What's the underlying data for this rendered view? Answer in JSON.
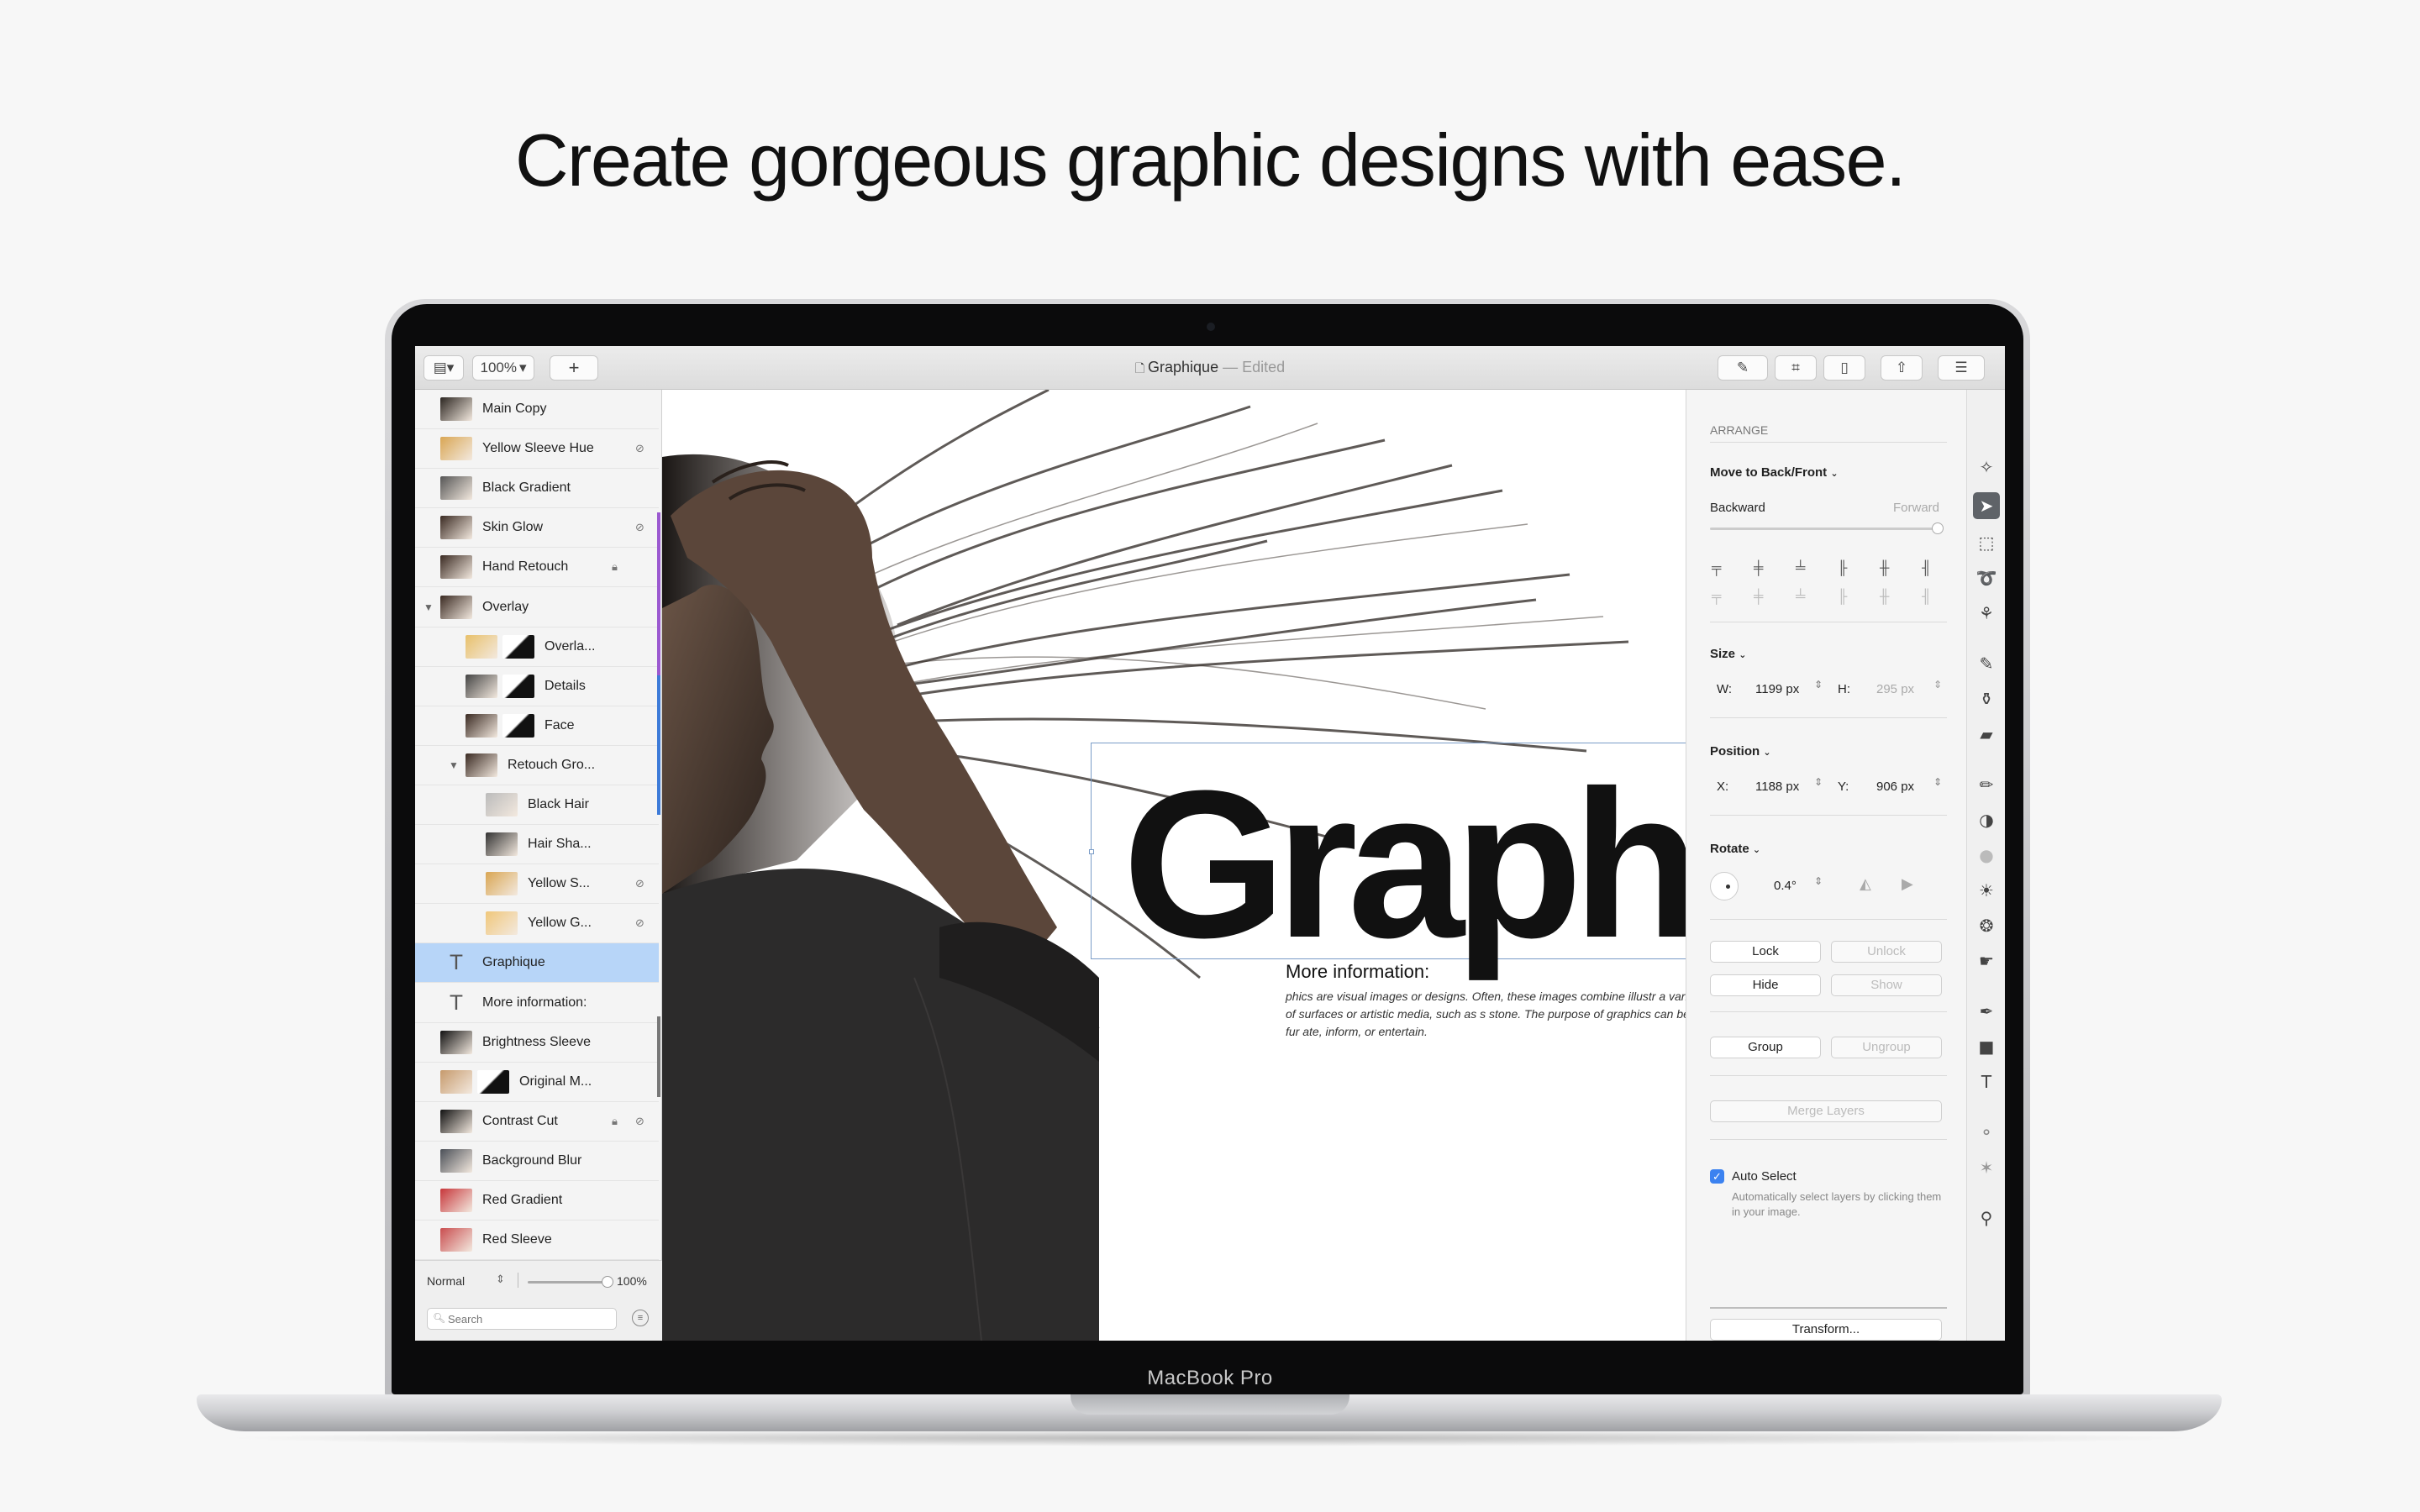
{
  "headline": "Create gorgeous graphic designs with ease.",
  "device_label": "MacBook Pro",
  "toolbar": {
    "view_icon": "sidebar-icon",
    "zoom": "100%",
    "add_label": "+",
    "doc_name": "Graphique",
    "doc_separator": " — ",
    "doc_state": "Edited",
    "right_buttons": [
      "brush-icon",
      "crop-icon",
      "document-icon",
      "share-icon",
      "sliders-icon"
    ]
  },
  "layers": [
    {
      "label": "Main Copy",
      "thumb": "#2b2520",
      "indent": 0
    },
    {
      "label": "Yellow Sleeve Hue",
      "thumb": "#d9a653",
      "indent": 0,
      "badge": "hidden-icon"
    },
    {
      "label": "Black Gradient",
      "thumb": "#555",
      "indent": 0
    },
    {
      "label": "Skin Glow",
      "thumb": "#3a2a22",
      "indent": 0,
      "badge": "hidden-icon"
    },
    {
      "label": "Hand Retouch",
      "thumb": "#3a2a22",
      "indent": 0,
      "badge": "lock-icon"
    },
    {
      "label": "Overlay",
      "thumb": "#3a2a22",
      "indent": 0,
      "group": "open"
    },
    {
      "label": "Overla...",
      "thumb": "#e8c06a",
      "thumb2": "#111",
      "indent": 1
    },
    {
      "label": "Details",
      "thumb": "#444",
      "thumb2": "#111",
      "indent": 1
    },
    {
      "label": "Face",
      "thumb": "#3a2a22",
      "thumb2": "#111",
      "indent": 1
    },
    {
      "label": "Retouch Gro...",
      "thumb": "#3a2a22",
      "indent": 1,
      "group": "open"
    },
    {
      "label": "Black Hair",
      "thumb": "#bbb",
      "indent": 2
    },
    {
      "label": "Hair Sha...",
      "thumb": "#333",
      "indent": 2
    },
    {
      "label": "Yellow S...",
      "thumb": "#d9a653",
      "indent": 2,
      "badge": "hidden-icon"
    },
    {
      "label": "Yellow G...",
      "thumb": "#f0c77a",
      "indent": 2,
      "badge": "hidden-icon"
    },
    {
      "label": "Graphique",
      "type": "text",
      "indent": 0,
      "selected": true
    },
    {
      "label": "More information:",
      "type": "text",
      "indent": 0
    },
    {
      "label": "Brightness Sleeve",
      "thumb": "#111",
      "indent": 0
    },
    {
      "label": "Original M...",
      "thumb": "#c69a6c",
      "thumb2": "#111",
      "indent": 0
    },
    {
      "label": "Contrast Cut",
      "thumb": "#111",
      "indent": 0,
      "badge": "lock-icon",
      "badge2": "hidden-icon"
    },
    {
      "label": "Background Blur",
      "thumb": "#4a4f57",
      "indent": 0
    },
    {
      "label": "Red Gradient",
      "thumb": "#c7363a",
      "indent": 0
    },
    {
      "label": "Red Sleeve",
      "thumb": "#c94d4f",
      "indent": 0
    }
  ],
  "layers_footer": {
    "blend_mode": "Normal",
    "opacity": "100%",
    "opacity_value": 1.0,
    "search_placeholder": "Search"
  },
  "canvas": {
    "big_word": "Graphic",
    "more_title": "More information:",
    "more_body": "phics are visual images or designs. Often, these images combine illustr a variety of surfaces or artistic media, such as s stone. The purpose of graphics can be fur ate, inform, or entertain."
  },
  "inspector": {
    "section_title": "ARRANGE",
    "move_label": "Move to Back/Front",
    "backward": "Backward",
    "forward": "Forward",
    "size_label": "Size",
    "w_label": "W:",
    "w_value": "1199 px",
    "h_label": "H:",
    "h_value": "295 px",
    "position_label": "Position",
    "x_label": "X:",
    "x_value": "1188 px",
    "y_label": "Y:",
    "y_value": "906 px",
    "rotate_label": "Rotate",
    "rotate_value": "0.4°",
    "lock": "Lock",
    "unlock": "Unlock",
    "hide": "Hide",
    "show": "Show",
    "group": "Group",
    "ungroup": "Ungroup",
    "merge": "Merge Layers",
    "auto_select_label": "Auto Select",
    "auto_select_checked": true,
    "auto_select_desc": "Automatically select layers by clicking them in your image.",
    "transform": "Transform..."
  },
  "tools": [
    "wand-icon",
    "arrow-icon",
    "marquee-icon",
    "lasso-icon",
    "magic-select-icon",
    "brush-icon",
    "bucket-icon",
    "eraser-icon",
    "pencil-icon",
    "clone-icon",
    "blur-icon",
    "sun-icon",
    "smudge-icon",
    "finger-icon",
    "pen-icon",
    "shape-icon",
    "text-icon",
    "layers-mix-icon",
    "star-icon",
    "zoom-icon"
  ],
  "colors": {
    "selection": "#b7d5f8",
    "group_purple": "#9b59d0",
    "group_blue": "#3d7bd8",
    "active_tool": "#5f6368"
  }
}
